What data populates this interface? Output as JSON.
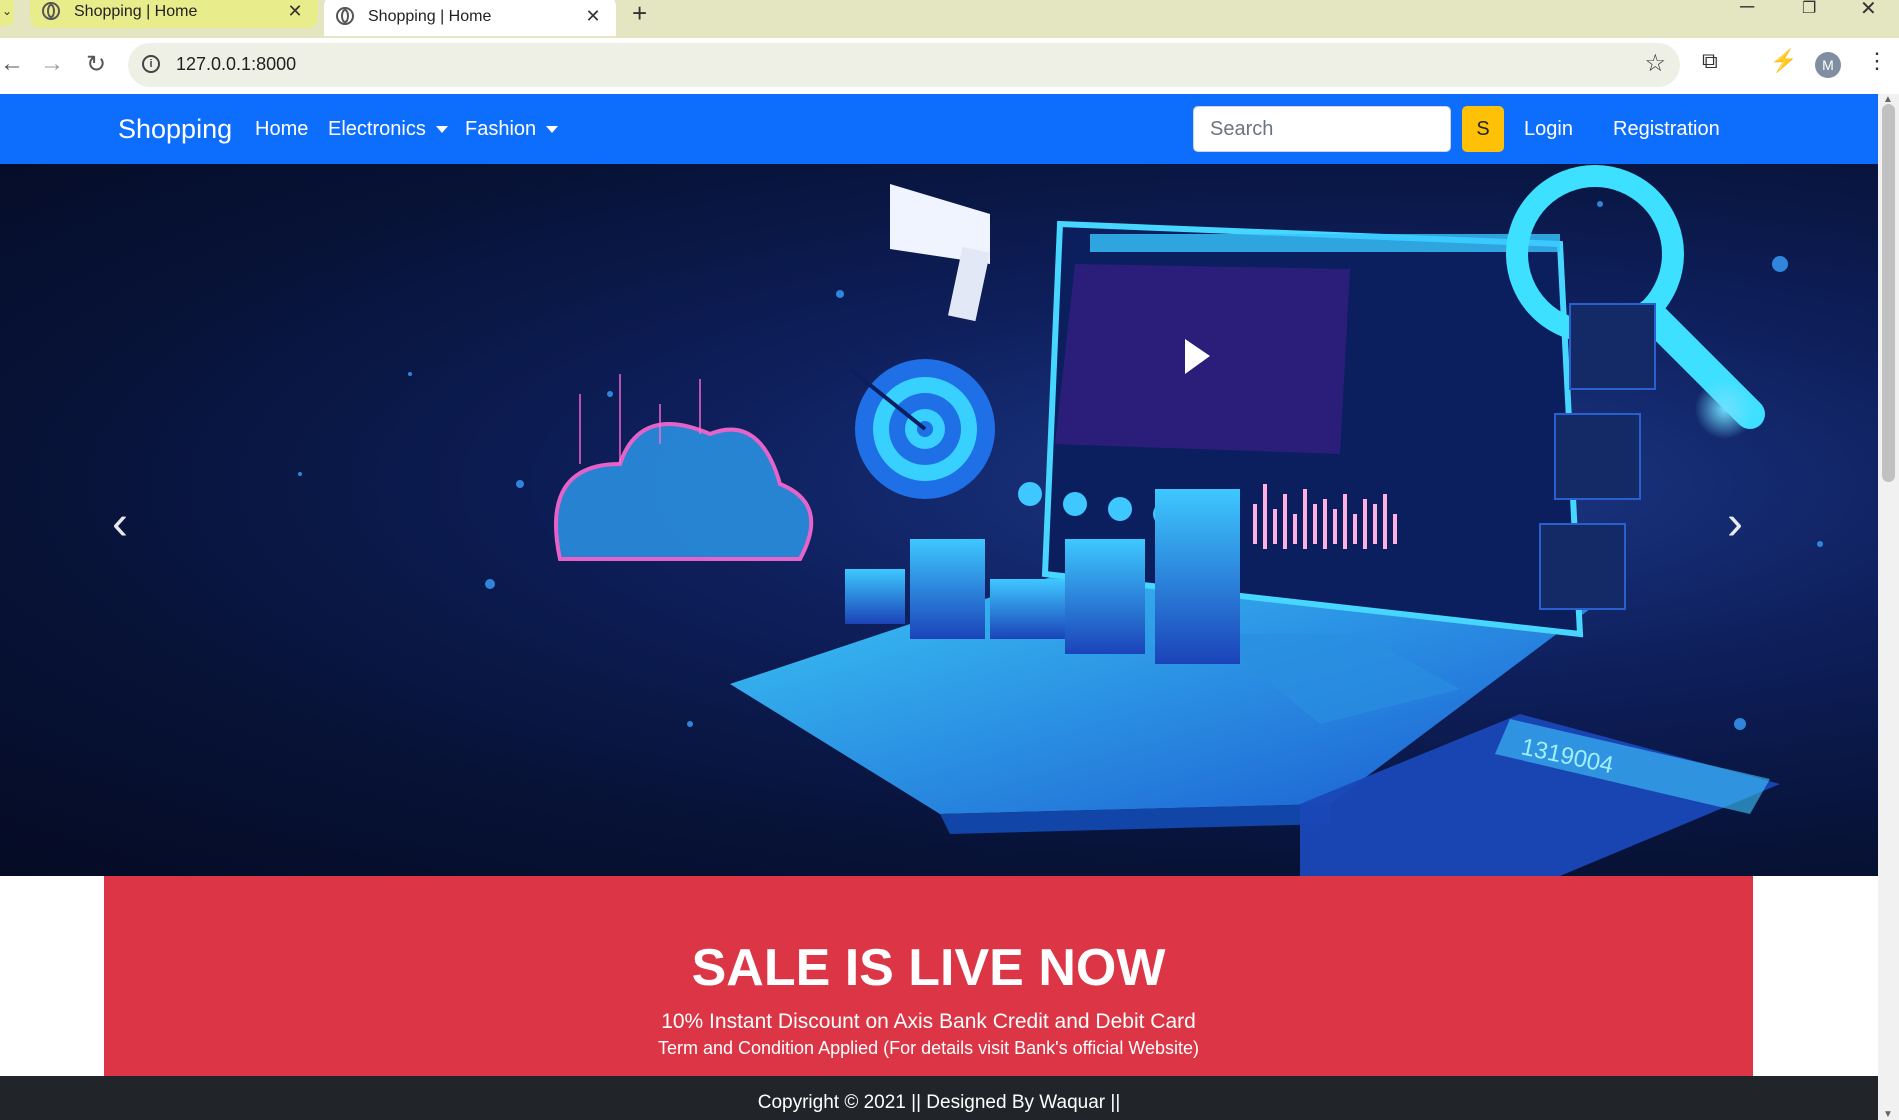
{
  "browser": {
    "tabs": [
      {
        "title": "Shopping | Home",
        "active": false
      },
      {
        "title": "Shopping | Home",
        "active": true
      }
    ],
    "new_tab": "+",
    "url": "127.0.0.1:8000",
    "profile_initial": "M",
    "window_controls": {
      "minimize": "─",
      "restore": "❐",
      "close": "✕"
    }
  },
  "navbar": {
    "brand": "Shopping",
    "links": [
      {
        "label": "Home"
      },
      {
        "label": "Electronics"
      },
      {
        "label": "Fashion"
      }
    ],
    "search": {
      "placeholder": "Search",
      "button_label": "S"
    },
    "login": "Login",
    "registration": "Registration",
    "colors": {
      "background": "#0d6efd",
      "search_button": "#ffc107"
    }
  },
  "carousel": {
    "prev_icon": "‹",
    "next_icon": "›",
    "calculator_display": "1319004"
  },
  "sale": {
    "title": "SALE IS LIVE NOW",
    "subtitle": "10% Instant Discount on Axis Bank Credit and Debit Card",
    "note": "Term and Condition Applied (For details visit Bank's official Website)",
    "background": "#dc3545"
  },
  "footer": {
    "text": "Copyright © 2021 || Designed By Waquar ||"
  }
}
